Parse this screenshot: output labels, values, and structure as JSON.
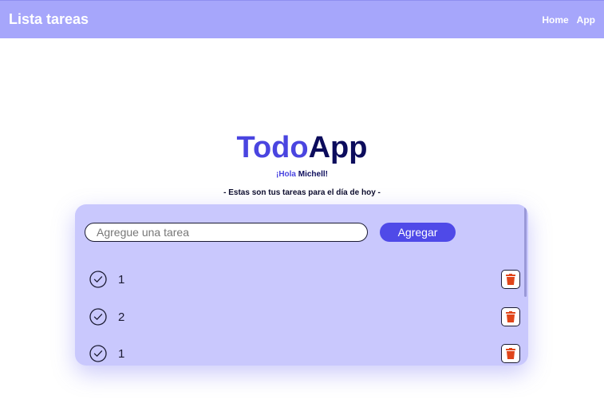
{
  "navbar": {
    "brand": "Lista tareas",
    "links": [
      "Home",
      "App"
    ]
  },
  "title": {
    "part1": "Todo",
    "part2": "App"
  },
  "greeting": {
    "hola": "¡Hola",
    "name": "Michell!"
  },
  "subtitle": "- Estas son tus tareas para el día de hoy -",
  "form": {
    "placeholder": "Agregue una tarea",
    "add_label": "Agregar"
  },
  "tasks": [
    {
      "text": "1"
    },
    {
      "text": "2"
    },
    {
      "text": "1"
    }
  ],
  "colors": {
    "navbar": "#a6a6fb",
    "accent": "#4a45e0",
    "dark": "#0c0c5c",
    "card": "#c9c8fd",
    "delete_icon": "#e0451a"
  }
}
